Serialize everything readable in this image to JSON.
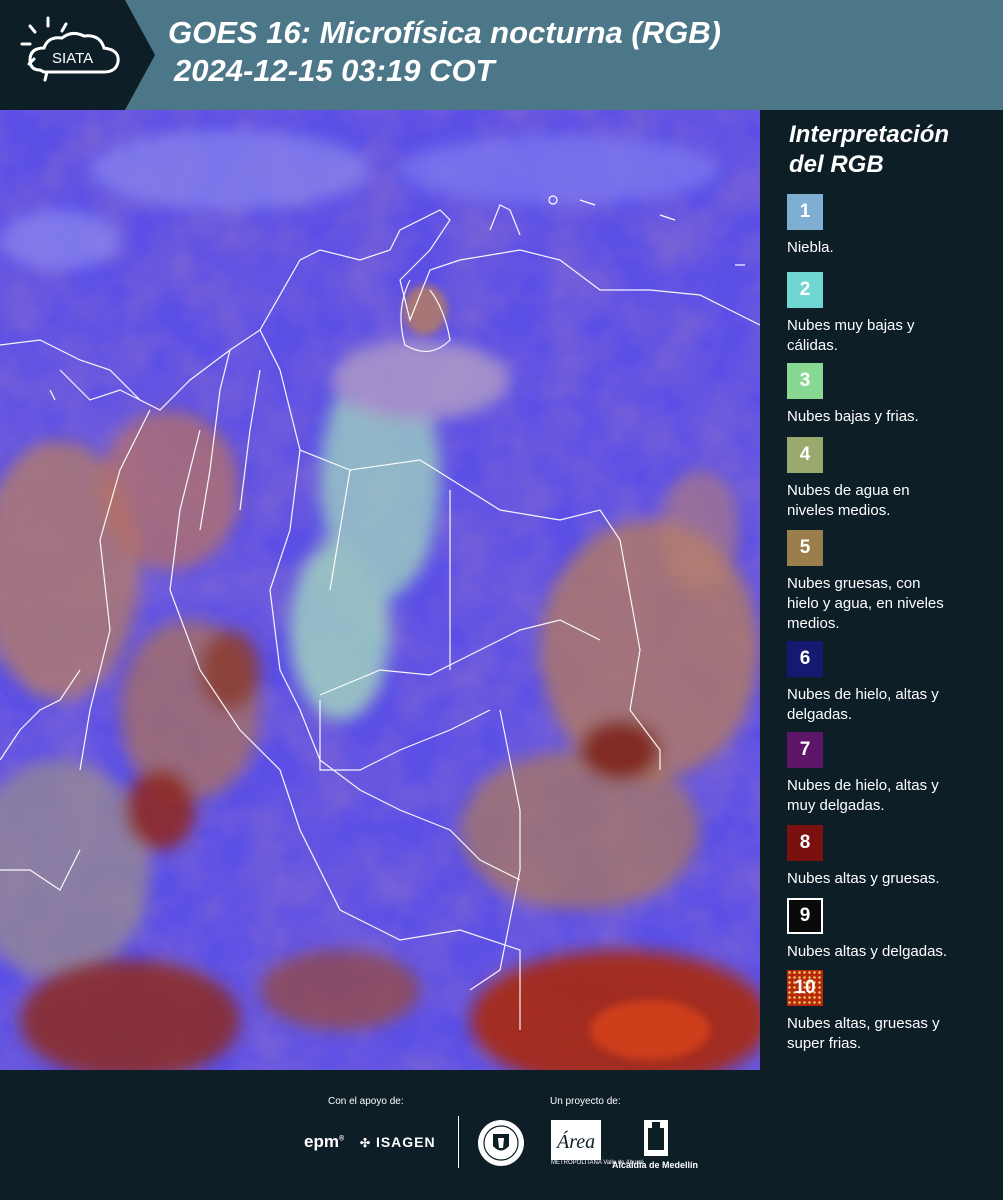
{
  "header": {
    "logo_text": "SIATA",
    "title_line1": "GOES 16: Microfísica nocturna (RGB)",
    "title_line2": "2024-12-15 03:19 COT",
    "background_color": "#4c7788"
  },
  "legend": {
    "title_line1": "Interpretación",
    "title_line2": "del RGB",
    "items": [
      {
        "number": "1",
        "color": "#7faed3",
        "label_lines": [
          "Niebla."
        ]
      },
      {
        "number": "2",
        "color": "#6fd6d2",
        "label_lines": [
          "Nubes muy bajas y",
          "cálidas."
        ]
      },
      {
        "number": "3",
        "color": "#88d894",
        "label_lines": [
          "Nubes bajas y frias."
        ]
      },
      {
        "number": "4",
        "color": "#9aa96e",
        "label_lines": [
          "Nubes de agua en",
          "niveles medios."
        ]
      },
      {
        "number": "5",
        "color": "#9a7f4d",
        "label_lines": [
          "Nubes gruesas, con",
          "hielo y agua, en niveles",
          "medios."
        ]
      },
      {
        "number": "6",
        "color": "#151a70",
        "label_lines": [
          "Nubes de hielo, altas y",
          "delgadas."
        ]
      },
      {
        "number": "7",
        "color": "#5c1568",
        "label_lines": [
          "Nubes de hielo, altas y",
          "muy delgadas."
        ]
      },
      {
        "number": "8",
        "color": "#7a1010",
        "label_lines": [
          "Nubes altas y gruesas."
        ]
      },
      {
        "number": "9",
        "color": "#0a0a0a",
        "label_lines": [
          "Nubes altas y delgadas."
        ]
      },
      {
        "number": "10",
        "color": "#b8280c",
        "label_lines": [
          "Nubes altas, gruesas y",
          "super frias."
        ]
      }
    ]
  },
  "footer": {
    "support_label": "Con el apoyo de:",
    "project_label": "Un proyecto de:",
    "sponsor1": "epm",
    "sponsor2": "ISAGEN",
    "area_metropolitana_text": "METROPOLITANA Valle de Aburrá",
    "area_logo_script": "Área",
    "alcaldia_text": "Alcaldía de Medellín"
  }
}
